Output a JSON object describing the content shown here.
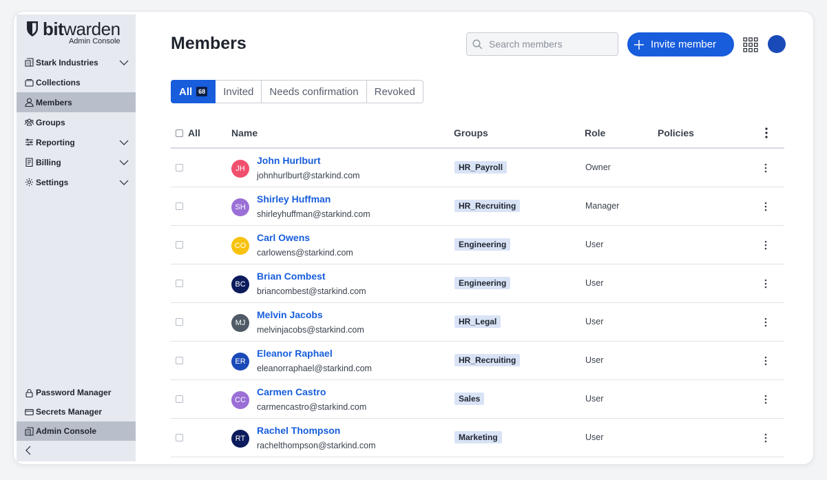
{
  "brand": {
    "logo_bold": "bit",
    "logo_light": "warden",
    "subtitle": "Admin Console"
  },
  "sidebar": {
    "items": [
      {
        "label": "Stark Industries",
        "icon": "building-icon",
        "expandable": true
      },
      {
        "label": "Collections",
        "icon": "collection-icon",
        "expandable": false
      },
      {
        "label": "Members",
        "icon": "user-icon",
        "expandable": false,
        "active": true
      },
      {
        "label": "Groups",
        "icon": "users-icon",
        "expandable": false
      },
      {
        "label": "Reporting",
        "icon": "sliders-icon",
        "expandable": true
      },
      {
        "label": "Billing",
        "icon": "invoice-icon",
        "expandable": true
      },
      {
        "label": "Settings",
        "icon": "gear-icon",
        "expandable": true
      }
    ],
    "bottom_items": [
      {
        "label": "Password Manager",
        "icon": "lock-icon"
      },
      {
        "label": "Secrets Manager",
        "icon": "card-icon"
      },
      {
        "label": "Admin Console",
        "icon": "building-icon",
        "active": true
      }
    ]
  },
  "page": {
    "title": "Members"
  },
  "search": {
    "placeholder": "Search members"
  },
  "invite": {
    "label": "Invite member"
  },
  "tabs": [
    {
      "label": "All",
      "count": "68",
      "active": true
    },
    {
      "label": "Invited"
    },
    {
      "label": "Needs confirmation"
    },
    {
      "label": "Revoked"
    }
  ],
  "table": {
    "headers": {
      "all": "All",
      "name": "Name",
      "groups": "Groups",
      "role": "Role",
      "policies": "Policies"
    },
    "rows": [
      {
        "initials": "JH",
        "color": "#f0506e",
        "name": "John Hurlburt",
        "email": "johnhurlburt@starkind.com",
        "group": "HR_Payroll",
        "role": "Owner"
      },
      {
        "initials": "SH",
        "color": "#9a6fd6",
        "name": "Shirley Huffman",
        "email": "shirleyhuffman@starkind.com",
        "group": "HR_Recruiting",
        "role": "Manager"
      },
      {
        "initials": "CO",
        "color": "#f7c20c",
        "name": "Carl Owens",
        "email": "carlowens@starkind.com",
        "group": "Engineering",
        "role": "User"
      },
      {
        "initials": "BC",
        "color": "#0b1b5c",
        "name": "Brian Combest",
        "email": "briancombest@starkind.com",
        "group": "Engineering",
        "role": "User"
      },
      {
        "initials": "MJ",
        "color": "#4f5a66",
        "name": "Melvin Jacobs",
        "email": "melvinjacobs@starkind.com",
        "group": "HR_Legal",
        "role": "User"
      },
      {
        "initials": "ER",
        "color": "#1a49b8",
        "name": "Eleanor Raphael",
        "email": "eleanorraphael@starkind.com",
        "group": "HR_Recruiting",
        "role": "User"
      },
      {
        "initials": "CC",
        "color": "#9a6fd6",
        "name": "Carmen Castro",
        "email": "carmencastro@starkind.com",
        "group": "Sales",
        "role": "User"
      },
      {
        "initials": "RT",
        "color": "#0b1b5c",
        "name": "Rachel Thompson",
        "email": "rachelthompson@starkind.com",
        "group": "Marketing",
        "role": "User"
      }
    ]
  }
}
